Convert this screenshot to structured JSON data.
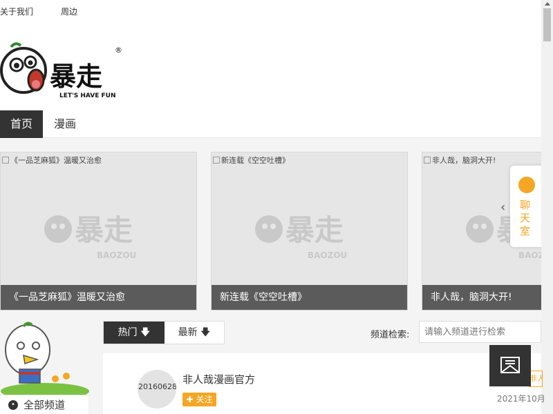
{
  "topbar": {
    "about": "关于我们",
    "merch": "周边"
  },
  "logo": {
    "title": "暴走",
    "slogan": "LET'S HAVE FUN",
    "reg": "®"
  },
  "nav": {
    "tabs": [
      {
        "label": "首页"
      },
      {
        "label": "漫画"
      }
    ]
  },
  "banners": [
    {
      "alt": "《一品芝麻狐》温暖又治愈",
      "caption": "《一品芝麻狐》温暖又治愈",
      "watermark": "BAOZOU"
    },
    {
      "alt": "新连载《空空吐槽》",
      "caption": "新连载《空空吐槽》",
      "watermark": "BAOZOU"
    },
    {
      "alt": "非人哉，脑洞大开!",
      "caption": "非人哉，脑洞大开!",
      "watermark": "BAOZOU"
    }
  ],
  "chat": {
    "label": "聊天室"
  },
  "sort": {
    "hot": "热门",
    "latest": "最新"
  },
  "search": {
    "label": "频道检索:",
    "placeholder": "请输入频道进行检索"
  },
  "sidebar": {
    "all_channels": "全部频道"
  },
  "feed": [
    {
      "avatar_alt": "20160628",
      "name": "非人哉漫画官方",
      "follow": "关注",
      "date": "2021年10月",
      "badge": "非人"
    }
  ],
  "colors": {
    "accent": "#f5a623",
    "dark": "#333333"
  }
}
